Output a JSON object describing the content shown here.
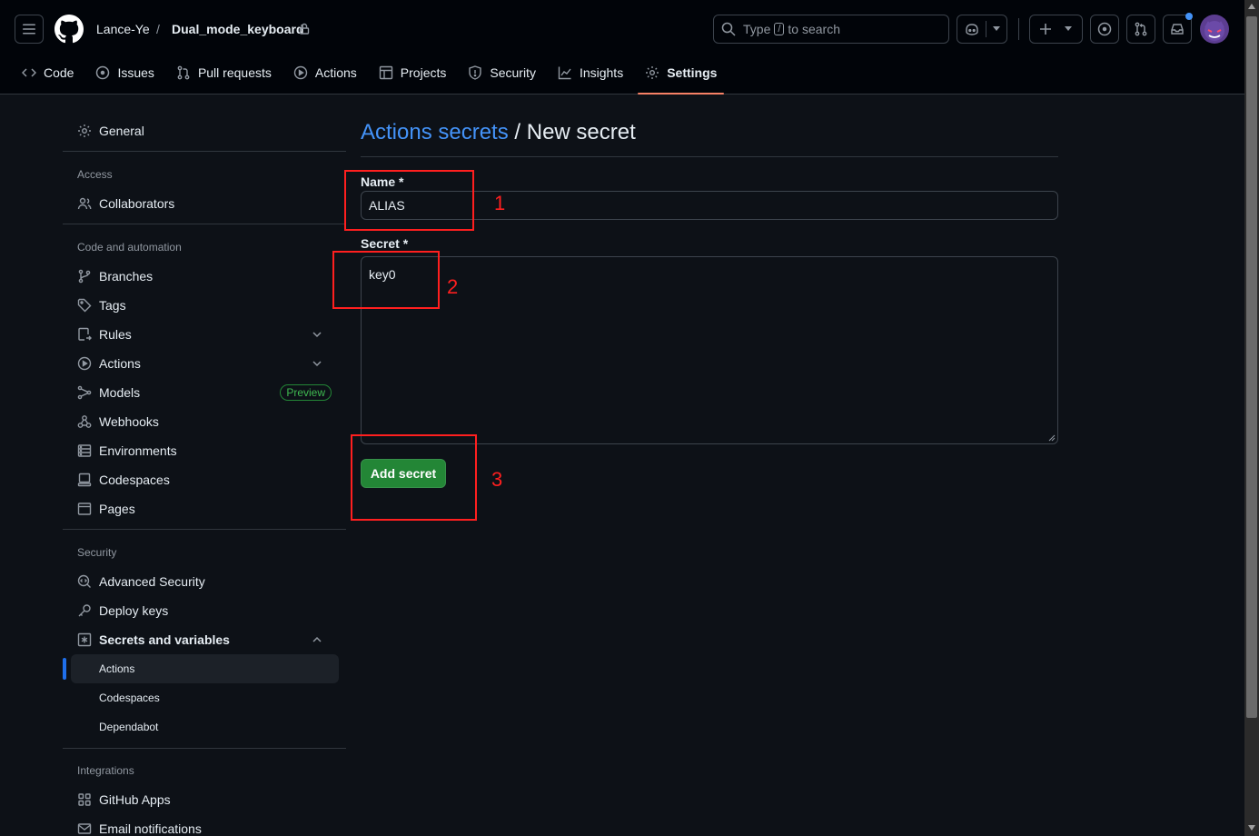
{
  "header": {
    "owner": "Lance-Ye",
    "separator": "/",
    "repo": "Dual_mode_keyboard",
    "search_prefix": "Type",
    "search_key": "/",
    "search_suffix": "to search"
  },
  "nav_tabs": [
    {
      "label": "Code",
      "icon": "code-icon"
    },
    {
      "label": "Issues",
      "icon": "issue-icon"
    },
    {
      "label": "Pull requests",
      "icon": "pull-request-icon"
    },
    {
      "label": "Actions",
      "icon": "play-icon"
    },
    {
      "label": "Projects",
      "icon": "table-icon"
    },
    {
      "label": "Security",
      "icon": "shield-icon"
    },
    {
      "label": "Insights",
      "icon": "graph-icon"
    },
    {
      "label": "Settings",
      "icon": "gear-icon",
      "active": true
    }
  ],
  "sidebar": {
    "general": "General",
    "access_heading": "Access",
    "collaborators": "Collaborators",
    "code_heading": "Code and automation",
    "branches": "Branches",
    "tags": "Tags",
    "rules": "Rules",
    "actions": "Actions",
    "models": "Models",
    "models_badge": "Preview",
    "webhooks": "Webhooks",
    "environments": "Environments",
    "codespaces": "Codespaces",
    "pages": "Pages",
    "security_heading": "Security",
    "advanced_security": "Advanced Security",
    "deploy_keys": "Deploy keys",
    "secrets_variables": "Secrets and variables",
    "sub_actions": "Actions",
    "sub_codespaces": "Codespaces",
    "sub_dependabot": "Dependabot",
    "integrations_heading": "Integrations",
    "github_apps": "GitHub Apps",
    "email_notifications": "Email notifications"
  },
  "main": {
    "title_link": "Actions secrets",
    "title_rest": " / New secret",
    "name_label": "Name *",
    "name_value": "ALIAS",
    "secret_label": "Secret *",
    "secret_value": "key0",
    "submit": "Add secret"
  },
  "annotations": {
    "one": "1",
    "two": "2",
    "three": "3",
    "color": "#ff1f1f"
  },
  "colors": {
    "accent_link": "#4493f8",
    "primary_button": "#238636",
    "tab_underline": "#f78166",
    "active_indicator": "#1f6feb"
  }
}
